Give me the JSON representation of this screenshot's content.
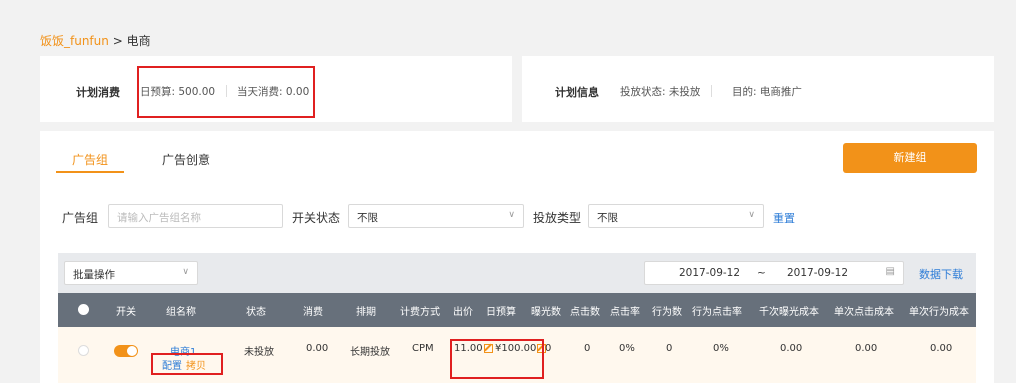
{
  "breadcrumb": {
    "link": "饭饭_funfun",
    "separator": " > ",
    "current": "电商"
  },
  "plan_cost": {
    "label": "计划消费",
    "daily_budget": "日预算: 500.00",
    "today_spend": "当天消费: 0.00"
  },
  "plan_info": {
    "label": "计划信息",
    "status": "投放状态: 未投放",
    "goal": "目的: 电商推广"
  },
  "tabs": [
    {
      "label": "广告组",
      "active": true
    },
    {
      "label": "广告创意",
      "active": false
    }
  ],
  "new_group_button": "新建组",
  "filters": {
    "group_label": "广告组",
    "group_placeholder": "请输入广告组名称",
    "switch_label": "开关状态",
    "switch_value": "不限",
    "delivery_label": "投放类型",
    "delivery_value": "不限",
    "reset": "重置"
  },
  "toolbar": {
    "batch": "批量操作",
    "date_from": "2017-09-12",
    "date_sep": "~",
    "date_to": "2017-09-12",
    "download": "数据下载"
  },
  "table": {
    "headers": [
      "开关",
      "组名称",
      "状态",
      "消费",
      "排期",
      "计费方式",
      "出价",
      "日预算",
      "曝光数",
      "点击数",
      "点击率",
      "行为数",
      "行为点击率",
      "千次曝光成本",
      "单次点击成本",
      "单次行为成本"
    ],
    "row": {
      "name": "电商1",
      "status": "未投放",
      "spend": "0.00",
      "schedule": "长期投放",
      "billing": "CPM",
      "bid": "11.00",
      "budget": "¥100.00",
      "impressions": "0",
      "clicks": "0",
      "ctr": "0%",
      "actions": "0",
      "action_rate": "0%",
      "cpm_cost": "0.00",
      "cpc_cost": "0.00",
      "cpa_cost": "0.00",
      "config": "配置",
      "copy": "拷贝"
    }
  },
  "colors": {
    "accent": "#f29219",
    "link": "#2e7dd7",
    "header_bg": "#67707b",
    "highlight": "#e02020"
  }
}
